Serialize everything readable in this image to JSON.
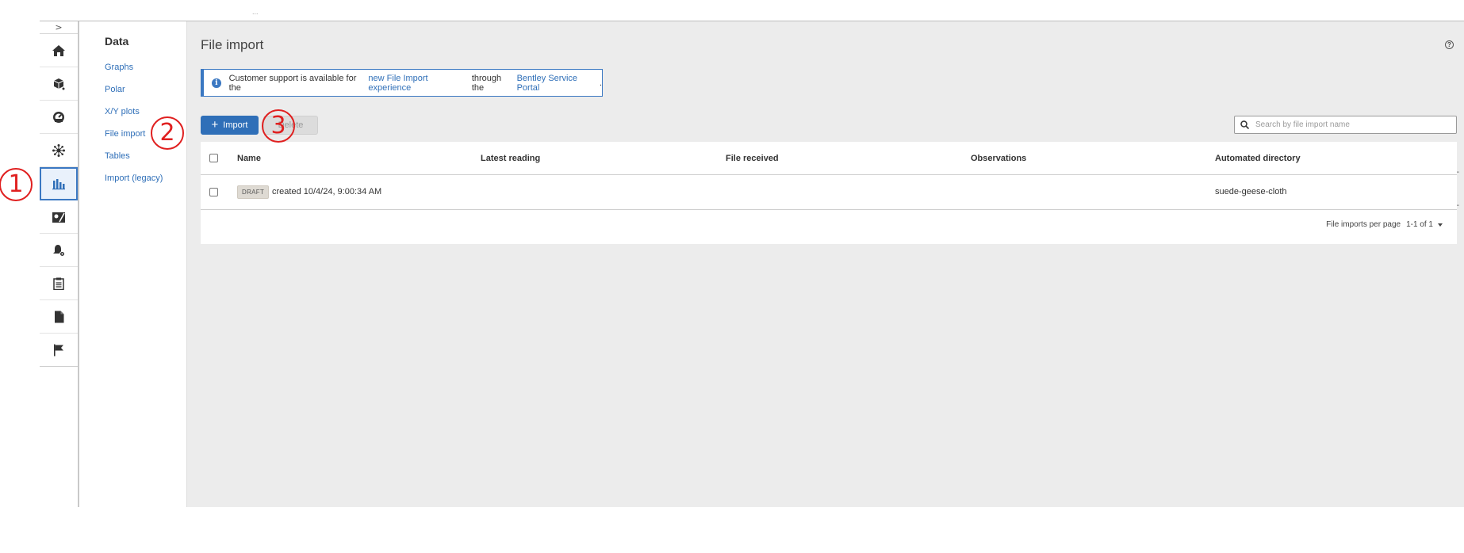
{
  "top_crumb": "...",
  "rail": {
    "toggle_label": ">",
    "items": [
      {
        "name": "home",
        "icon": "home-icon"
      },
      {
        "name": "objects",
        "icon": "cube-icon"
      },
      {
        "name": "dashboard",
        "icon": "gauge-icon"
      },
      {
        "name": "network",
        "icon": "network-icon"
      },
      {
        "name": "data",
        "icon": "bar-chart-icon",
        "active": true
      },
      {
        "name": "map",
        "icon": "map-icon"
      },
      {
        "name": "alerts",
        "icon": "bell-gear-icon"
      },
      {
        "name": "reports",
        "icon": "clipboard-icon"
      },
      {
        "name": "documents",
        "icon": "document-icon"
      },
      {
        "name": "flags",
        "icon": "flag-icon"
      }
    ]
  },
  "subnav": {
    "title": "Data",
    "links": [
      "Graphs",
      "Polar",
      "X/Y plots",
      "File import",
      "Tables",
      "Import (legacy)"
    ]
  },
  "main": {
    "title": "File import",
    "help_label": "?",
    "banner": {
      "text_before": "Customer support is available for the ",
      "link1": "new File Import experience",
      "text_middle": " through the ",
      "link2": "Bentley Service Portal",
      "text_after": "."
    },
    "import_label": "Import",
    "delete_label": "Delete",
    "search_placeholder": "Search by file import name",
    "table": {
      "columns": [
        "Name",
        "Latest reading",
        "File received",
        "Observations",
        "Automated directory"
      ],
      "rows": [
        {
          "status": "DRAFT",
          "name": "created 10/4/24, 9:00:34 AM",
          "latest_reading": "",
          "file_received": "",
          "observations": "",
          "automated_directory": "suede-geese-cloth"
        }
      ],
      "per_page_label": "File imports per page",
      "range": "1-1 of 1",
      "right_edge_marker": "-"
    }
  },
  "annotations": [
    "1",
    "2",
    "3"
  ],
  "colors": {
    "accent": "#2f6fb8",
    "annotation": "#e02020",
    "background": "#ececec"
  }
}
